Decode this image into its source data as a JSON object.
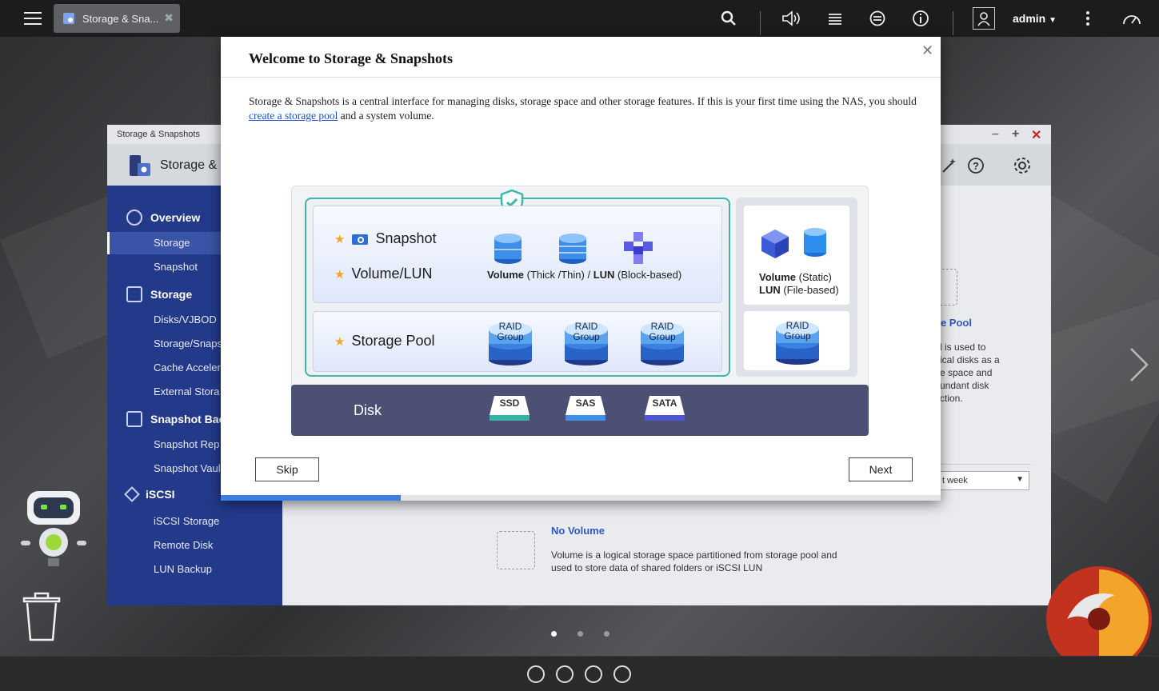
{
  "taskbar": {
    "tab_label": "Storage & Sna...",
    "user": "admin"
  },
  "bg_window": {
    "title_small": "Storage & Snapshots",
    "app_title": "Storage &",
    "sidebar": {
      "overview": "Overview",
      "overview_items": [
        "Storage",
        "Snapshot"
      ],
      "storage": "Storage",
      "storage_items": [
        "Disks/VJBOD",
        "Storage/Snaps",
        "Cache Acceler",
        "External Stora"
      ],
      "snapshot_backup": "Snapshot Back",
      "snapshot_backup_items": [
        "Snapshot Rep",
        "Snapshot Vaul"
      ],
      "iscsi": "iSCSI",
      "iscsi_items": [
        "iSCSI Storage",
        "Remote Disk",
        "LUN Backup"
      ]
    },
    "pool_heading": "ge Pool",
    "pool_desc_lines": [
      "l is used to",
      "ical disks as a",
      "e space and",
      "undant disk",
      "ction."
    ],
    "week_select": "t week",
    "no_volume_title": "No Volume",
    "no_volume_desc_1": "Volume is a logical storage space partitioned from storage pool and",
    "no_volume_desc_2": "used to store data of shared folders or iSCSI LUN"
  },
  "modal": {
    "title": "Welcome to Storage & Snapshots",
    "desc_before": "Storage & Snapshots is a central interface for managing disks, storage space and other storage features. If this is your first time using the NAS, you should ",
    "desc_link": "create a storage pool",
    "desc_after": " and a system volume.",
    "skip": "Skip",
    "next": "Next",
    "progress_fraction": 0.25
  },
  "diagram": {
    "snapshot": "Snapshot",
    "volume_lun": "Volume/LUN",
    "storage_pool": "Storage Pool",
    "vol_caption_bold": "Volume",
    "vol_caption_rest": " (Thick /Thin)",
    "lun_sep": " / ",
    "lun_caption_bold": "LUN",
    "lun_caption_rest": " (Block-based)",
    "raid_line1": "RAID",
    "raid_line2": "Group",
    "right_volume_bold": "Volume",
    "right_volume_rest": " (Static)",
    "right_lun_bold": "LUN",
    "right_lun_rest": " (File-based)",
    "disk": "Disk",
    "disk_types": [
      "SSD",
      "SAS",
      "SATA"
    ]
  },
  "colors": {
    "accent_teal": "#3ab8a9",
    "sidebar_blue": "#233a8b",
    "disk_bar": "#4b5074",
    "progress": "#3d7fe0",
    "star": "#f5a623"
  }
}
